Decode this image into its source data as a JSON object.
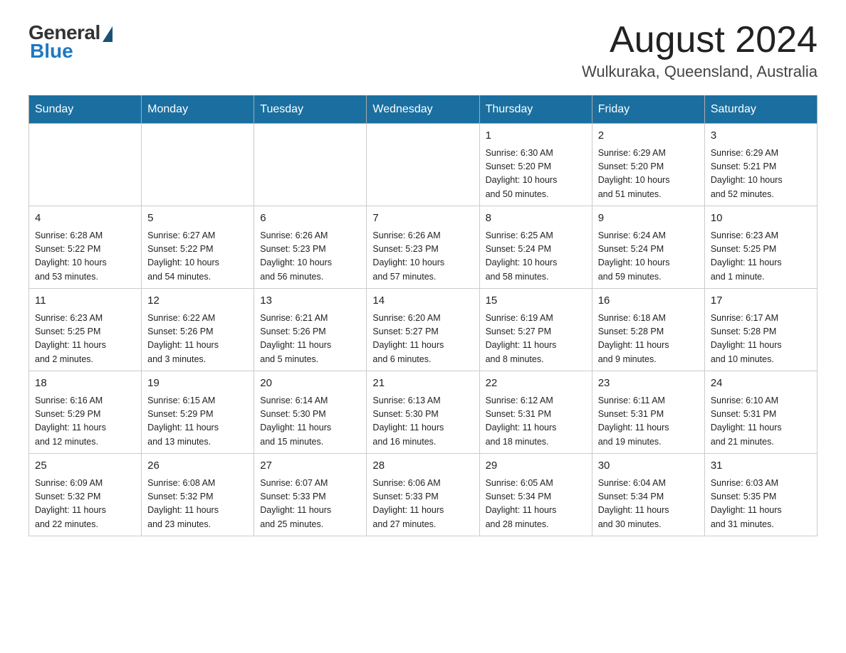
{
  "header": {
    "logo": {
      "general": "General",
      "blue": "Blue"
    },
    "title": "August 2024",
    "location": "Wulkuraka, Queensland, Australia"
  },
  "days_of_week": [
    "Sunday",
    "Monday",
    "Tuesday",
    "Wednesday",
    "Thursday",
    "Friday",
    "Saturday"
  ],
  "weeks": [
    [
      {
        "day": "",
        "info": ""
      },
      {
        "day": "",
        "info": ""
      },
      {
        "day": "",
        "info": ""
      },
      {
        "day": "",
        "info": ""
      },
      {
        "day": "1",
        "info": "Sunrise: 6:30 AM\nSunset: 5:20 PM\nDaylight: 10 hours\nand 50 minutes."
      },
      {
        "day": "2",
        "info": "Sunrise: 6:29 AM\nSunset: 5:20 PM\nDaylight: 10 hours\nand 51 minutes."
      },
      {
        "day": "3",
        "info": "Sunrise: 6:29 AM\nSunset: 5:21 PM\nDaylight: 10 hours\nand 52 minutes."
      }
    ],
    [
      {
        "day": "4",
        "info": "Sunrise: 6:28 AM\nSunset: 5:22 PM\nDaylight: 10 hours\nand 53 minutes."
      },
      {
        "day": "5",
        "info": "Sunrise: 6:27 AM\nSunset: 5:22 PM\nDaylight: 10 hours\nand 54 minutes."
      },
      {
        "day": "6",
        "info": "Sunrise: 6:26 AM\nSunset: 5:23 PM\nDaylight: 10 hours\nand 56 minutes."
      },
      {
        "day": "7",
        "info": "Sunrise: 6:26 AM\nSunset: 5:23 PM\nDaylight: 10 hours\nand 57 minutes."
      },
      {
        "day": "8",
        "info": "Sunrise: 6:25 AM\nSunset: 5:24 PM\nDaylight: 10 hours\nand 58 minutes."
      },
      {
        "day": "9",
        "info": "Sunrise: 6:24 AM\nSunset: 5:24 PM\nDaylight: 10 hours\nand 59 minutes."
      },
      {
        "day": "10",
        "info": "Sunrise: 6:23 AM\nSunset: 5:25 PM\nDaylight: 11 hours\nand 1 minute."
      }
    ],
    [
      {
        "day": "11",
        "info": "Sunrise: 6:23 AM\nSunset: 5:25 PM\nDaylight: 11 hours\nand 2 minutes."
      },
      {
        "day": "12",
        "info": "Sunrise: 6:22 AM\nSunset: 5:26 PM\nDaylight: 11 hours\nand 3 minutes."
      },
      {
        "day": "13",
        "info": "Sunrise: 6:21 AM\nSunset: 5:26 PM\nDaylight: 11 hours\nand 5 minutes."
      },
      {
        "day": "14",
        "info": "Sunrise: 6:20 AM\nSunset: 5:27 PM\nDaylight: 11 hours\nand 6 minutes."
      },
      {
        "day": "15",
        "info": "Sunrise: 6:19 AM\nSunset: 5:27 PM\nDaylight: 11 hours\nand 8 minutes."
      },
      {
        "day": "16",
        "info": "Sunrise: 6:18 AM\nSunset: 5:28 PM\nDaylight: 11 hours\nand 9 minutes."
      },
      {
        "day": "17",
        "info": "Sunrise: 6:17 AM\nSunset: 5:28 PM\nDaylight: 11 hours\nand 10 minutes."
      }
    ],
    [
      {
        "day": "18",
        "info": "Sunrise: 6:16 AM\nSunset: 5:29 PM\nDaylight: 11 hours\nand 12 minutes."
      },
      {
        "day": "19",
        "info": "Sunrise: 6:15 AM\nSunset: 5:29 PM\nDaylight: 11 hours\nand 13 minutes."
      },
      {
        "day": "20",
        "info": "Sunrise: 6:14 AM\nSunset: 5:30 PM\nDaylight: 11 hours\nand 15 minutes."
      },
      {
        "day": "21",
        "info": "Sunrise: 6:13 AM\nSunset: 5:30 PM\nDaylight: 11 hours\nand 16 minutes."
      },
      {
        "day": "22",
        "info": "Sunrise: 6:12 AM\nSunset: 5:31 PM\nDaylight: 11 hours\nand 18 minutes."
      },
      {
        "day": "23",
        "info": "Sunrise: 6:11 AM\nSunset: 5:31 PM\nDaylight: 11 hours\nand 19 minutes."
      },
      {
        "day": "24",
        "info": "Sunrise: 6:10 AM\nSunset: 5:31 PM\nDaylight: 11 hours\nand 21 minutes."
      }
    ],
    [
      {
        "day": "25",
        "info": "Sunrise: 6:09 AM\nSunset: 5:32 PM\nDaylight: 11 hours\nand 22 minutes."
      },
      {
        "day": "26",
        "info": "Sunrise: 6:08 AM\nSunset: 5:32 PM\nDaylight: 11 hours\nand 23 minutes."
      },
      {
        "day": "27",
        "info": "Sunrise: 6:07 AM\nSunset: 5:33 PM\nDaylight: 11 hours\nand 25 minutes."
      },
      {
        "day": "28",
        "info": "Sunrise: 6:06 AM\nSunset: 5:33 PM\nDaylight: 11 hours\nand 27 minutes."
      },
      {
        "day": "29",
        "info": "Sunrise: 6:05 AM\nSunset: 5:34 PM\nDaylight: 11 hours\nand 28 minutes."
      },
      {
        "day": "30",
        "info": "Sunrise: 6:04 AM\nSunset: 5:34 PM\nDaylight: 11 hours\nand 30 minutes."
      },
      {
        "day": "31",
        "info": "Sunrise: 6:03 AM\nSunset: 5:35 PM\nDaylight: 11 hours\nand 31 minutes."
      }
    ]
  ]
}
